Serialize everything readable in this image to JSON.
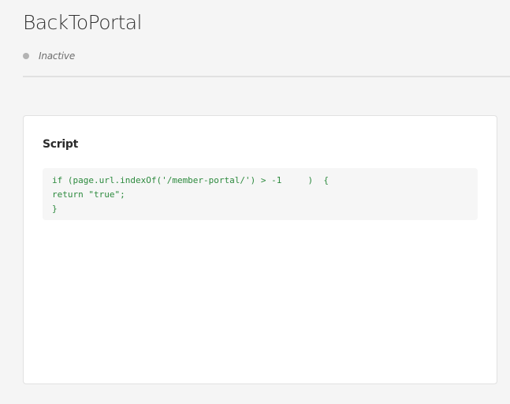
{
  "header": {
    "title": "BackToPortal",
    "status": {
      "label": "Inactive",
      "dot_color": "#b3b3b3"
    }
  },
  "script_card": {
    "title": "Script",
    "code_color": "#2d8a3e",
    "code_lines": [
      "if (page.url.indexOf('/member-portal/') > -1     )  {",
      "return \"true\";",
      "}"
    ]
  }
}
